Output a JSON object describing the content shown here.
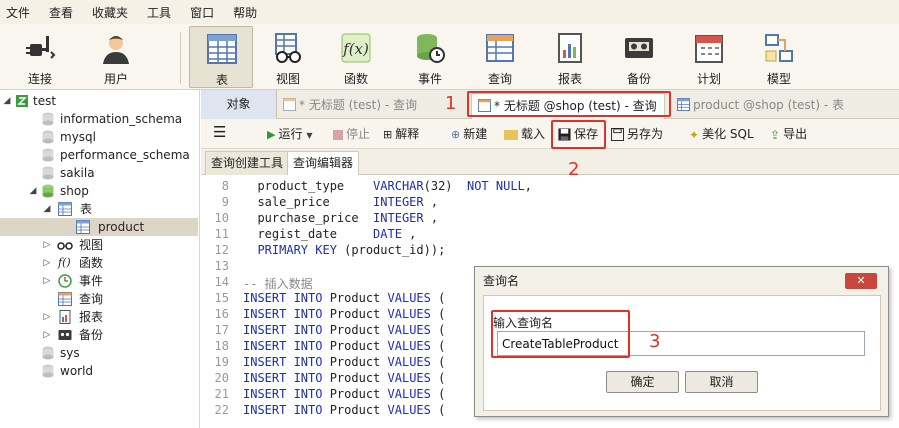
{
  "menu": [
    "文件",
    "查看",
    "收藏夹",
    "工具",
    "窗口",
    "帮助"
  ],
  "toolbar": {
    "connect": "连接",
    "user": "用户",
    "table": "表",
    "view": "视图",
    "function": "函数",
    "event": "事件",
    "query": "查询",
    "report": "报表",
    "backup": "备份",
    "schedule": "计划",
    "model": "模型"
  },
  "tree": {
    "root": "test",
    "dbs": [
      "information_schema",
      "mysql",
      "performance_schema",
      "sakila"
    ],
    "shop": "shop",
    "tables_node": "表",
    "table_product": "product",
    "children": [
      "视图",
      "函数",
      "事件",
      "查询",
      "报表",
      "备份"
    ],
    "dbs_after": [
      "sys",
      "world"
    ]
  },
  "tabs": {
    "objects": "对象",
    "tab1": "* 无标题 (test) - 查询",
    "tab2": "* 无标题 @shop (test) - 查询",
    "tab3": "product @shop (test) - 表"
  },
  "editor_toolbar": {
    "run": "运行",
    "stop": "停止",
    "explain": "解释",
    "new": "新建",
    "load": "载入",
    "save": "保存",
    "save_as": "另存为",
    "beautify": "美化 SQL",
    "export": "导出"
  },
  "subtabs": {
    "builder": "查询创建工具",
    "editor": "查询编辑器"
  },
  "code": {
    "lines": [
      {
        "n": "8",
        "parts": [
          [
            "t",
            "  product_type    "
          ],
          [
            "k",
            "VARCHAR"
          ],
          [
            "t",
            "(32)  "
          ],
          [
            "k",
            "NOT NULL"
          ],
          [
            "t",
            ","
          ]
        ]
      },
      {
        "n": "9",
        "parts": [
          [
            "t",
            "  sale_price      "
          ],
          [
            "k",
            "INTEGER"
          ],
          [
            "t",
            " ,"
          ]
        ]
      },
      {
        "n": "10",
        "parts": [
          [
            "t",
            "  purchase_price  "
          ],
          [
            "k",
            "INTEGER"
          ],
          [
            "t",
            " ,"
          ]
        ]
      },
      {
        "n": "11",
        "parts": [
          [
            "t",
            "  regist_date     "
          ],
          [
            "k",
            "DATE"
          ],
          [
            "t",
            " ,"
          ]
        ]
      },
      {
        "n": "12",
        "parts": [
          [
            "k",
            "  PRIMARY KEY"
          ],
          [
            "t",
            " (product_id));"
          ]
        ]
      },
      {
        "n": "13",
        "parts": []
      },
      {
        "n": "14",
        "parts": [
          [
            "c",
            "-- 插入数据"
          ]
        ]
      },
      {
        "n": "15",
        "parts": [
          [
            "k",
            "INSERT INTO"
          ],
          [
            "t",
            " Product "
          ],
          [
            "k",
            "VALUES"
          ],
          [
            "t",
            " ("
          ]
        ]
      },
      {
        "n": "16",
        "parts": [
          [
            "k",
            "INSERT INTO"
          ],
          [
            "t",
            " Product "
          ],
          [
            "k",
            "VALUES"
          ],
          [
            "t",
            " ("
          ]
        ]
      },
      {
        "n": "17",
        "parts": [
          [
            "k",
            "INSERT INTO"
          ],
          [
            "t",
            " Product "
          ],
          [
            "k",
            "VALUES"
          ],
          [
            "t",
            " ("
          ]
        ]
      },
      {
        "n": "18",
        "parts": [
          [
            "k",
            "INSERT INTO"
          ],
          [
            "t",
            " Product "
          ],
          [
            "k",
            "VALUES"
          ],
          [
            "t",
            " ("
          ]
        ]
      },
      {
        "n": "19",
        "parts": [
          [
            "k",
            "INSERT INTO"
          ],
          [
            "t",
            " Product "
          ],
          [
            "k",
            "VALUES"
          ],
          [
            "t",
            " ("
          ]
        ]
      },
      {
        "n": "20",
        "parts": [
          [
            "k",
            "INSERT INTO"
          ],
          [
            "t",
            " Product "
          ],
          [
            "k",
            "VALUES"
          ],
          [
            "t",
            " ("
          ]
        ]
      },
      {
        "n": "21",
        "parts": [
          [
            "k",
            "INSERT INTO"
          ],
          [
            "t",
            " Product "
          ],
          [
            "k",
            "VALUES"
          ],
          [
            "t",
            " ("
          ]
        ]
      },
      {
        "n": "22",
        "parts": [
          [
            "k",
            "INSERT INTO"
          ],
          [
            "t",
            " Product "
          ],
          [
            "k",
            "VALUES"
          ],
          [
            "t",
            " ("
          ]
        ]
      }
    ]
  },
  "dialog": {
    "title": "查询名",
    "label": "输入查询名",
    "value": "CreateTableProduct",
    "ok": "确定",
    "cancel": "取消"
  },
  "annotations": [
    "1",
    "2",
    "3"
  ],
  "colors": {
    "annotation": "#e03228",
    "accent": "#1d2fb0"
  }
}
